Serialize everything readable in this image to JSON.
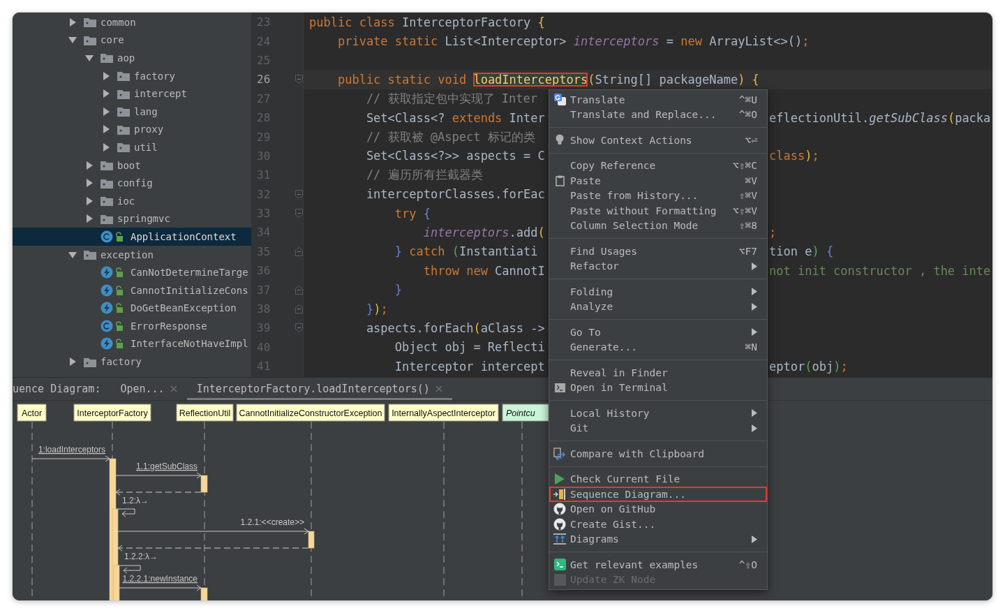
{
  "tree": [
    {
      "label": "common",
      "kind": "package",
      "expanded": false,
      "selected": false
    },
    {
      "label": "core",
      "kind": "package",
      "expanded": true,
      "selected": false,
      "children": [
        {
          "label": "aop",
          "kind": "package",
          "expanded": true,
          "selected": false,
          "children": [
            {
              "label": "factory",
              "kind": "package",
              "expanded": false,
              "selected": false
            },
            {
              "label": "intercept",
              "kind": "package",
              "expanded": false,
              "selected": false
            },
            {
              "label": "lang",
              "kind": "package",
              "expanded": false,
              "selected": false
            },
            {
              "label": "proxy",
              "kind": "package",
              "expanded": false,
              "selected": false
            },
            {
              "label": "util",
              "kind": "package",
              "expanded": false,
              "selected": false
            }
          ]
        },
        {
          "label": "boot",
          "kind": "package",
          "expanded": false,
          "selected": false
        },
        {
          "label": "config",
          "kind": "package",
          "expanded": false,
          "selected": false
        },
        {
          "label": "ioc",
          "kind": "package",
          "expanded": false,
          "selected": false
        },
        {
          "label": "springmvc",
          "kind": "package",
          "expanded": false,
          "selected": false
        },
        {
          "label": "ApplicationContext",
          "kind": "class",
          "selected": true
        }
      ]
    },
    {
      "label": "exception",
      "kind": "package",
      "expanded": true,
      "selected": false,
      "children": [
        {
          "label": "CanNotDetermineTarge",
          "kind": "exception",
          "selected": false
        },
        {
          "label": "CannotInitializeCons",
          "kind": "exception",
          "selected": false
        },
        {
          "label": "DoGetBeanException",
          "kind": "exception",
          "selected": false
        },
        {
          "label": "ErrorResponse",
          "kind": "class",
          "selected": false
        },
        {
          "label": "InterfaceNotHaveImpl",
          "kind": "exception",
          "selected": false
        }
      ]
    },
    {
      "label": "factory",
      "kind": "package",
      "expanded": false,
      "selected": false
    }
  ],
  "editor": {
    "lines": [
      {
        "number": "23",
        "current": false,
        "tokens": [
          {
            "text": "public class ",
            "kind": "keyword"
          },
          {
            "text": "InterceptorFactory ",
            "kind": "plain"
          },
          {
            "text": "{",
            "kind": "paren"
          }
        ]
      },
      {
        "number": "24",
        "current": false,
        "tokens": [
          {
            "text": "    private static ",
            "kind": "keyword"
          },
          {
            "text": "List<Interceptor> ",
            "kind": "plain"
          },
          {
            "text": "interceptors",
            "kind": "field"
          },
          {
            "text": " = ",
            "kind": "plain"
          },
          {
            "text": "new ",
            "kind": "keyword"
          },
          {
            "text": "ArrayList<>()",
            "kind": "plain"
          },
          {
            "text": ";",
            "kind": "keyword"
          }
        ]
      },
      {
        "number": "25",
        "current": false
      },
      {
        "number": "26",
        "current": true,
        "fold_start": true,
        "tokens": [
          {
            "text": "    public static void ",
            "kind": "keyword"
          },
          {
            "text": "loadInterceptors",
            "kind": "method",
            "boxed": true
          },
          {
            "text": "(",
            "kind": "paren"
          },
          {
            "text": "String[] packageName",
            "kind": "plain"
          },
          {
            "text": ")",
            "kind": "paren"
          },
          {
            "text": " {",
            "kind": "paren"
          }
        ]
      },
      {
        "number": "27",
        "current": false,
        "tokens": [
          {
            "text": "        // 获取指定包中实现了 Inter",
            "kind": "comment"
          }
        ]
      },
      {
        "number": "28",
        "current": false,
        "tokens": [
          {
            "text": "        Set<Class<? ",
            "kind": "plain"
          },
          {
            "text": "extends ",
            "kind": "keyword"
          },
          {
            "text": "Inter",
            "kind": "plain"
          }
        ],
        "tail": [
          {
            "text": "eflectionUtil.",
            "kind": "plain"
          },
          {
            "text": "getSubClass",
            "kind": "static"
          },
          {
            "text": "(",
            "kind": "paren"
          },
          {
            "text": "packa",
            "kind": "plain"
          }
        ]
      },
      {
        "number": "29",
        "current": false,
        "tokens": [
          {
            "text": "        // 获取被 @Aspect 标记的类",
            "kind": "comment"
          }
        ]
      },
      {
        "number": "30",
        "current": false,
        "tokens": [
          {
            "text": "        Set<Class<?>> aspects = C",
            "kind": "plain"
          }
        ],
        "tail": [
          {
            "text": "class",
            "kind": "keyword"
          },
          {
            "text": ")",
            "kind": "paren"
          },
          {
            "text": ";",
            "kind": "keyword"
          }
        ]
      },
      {
        "number": "31",
        "current": false,
        "tokens": [
          {
            "text": "        // 遍历所有拦截器类",
            "kind": "comment"
          }
        ]
      },
      {
        "number": "32",
        "current": false,
        "fold_start": true,
        "tokens": [
          {
            "text": "        interceptorClasses.forEac",
            "kind": "plain"
          }
        ]
      },
      {
        "number": "33",
        "current": false,
        "fold_start": true,
        "tokens": [
          {
            "text": "            try ",
            "kind": "keyword"
          },
          {
            "text": "{",
            "kind": "brace"
          }
        ]
      },
      {
        "number": "34",
        "current": false,
        "tokens": [
          {
            "text": "                interceptors",
            "kind": "field"
          },
          {
            "text": ".add",
            "kind": "plain"
          },
          {
            "text": "(",
            "kind": "paren"
          }
        ],
        "tail": [
          {
            "text": ";",
            "kind": "keyword"
          }
        ]
      },
      {
        "number": "35",
        "current": false,
        "fold_end": true,
        "tokens": [
          {
            "text": "            } ",
            "kind": "brace"
          },
          {
            "text": "catch ",
            "kind": "keyword"
          },
          {
            "text": "(",
            "kind": "paren2"
          },
          {
            "text": "Instantiati",
            "kind": "plain"
          }
        ],
        "tail": [
          {
            "text": "tion e",
            "kind": "plain"
          },
          {
            "text": ")",
            "kind": "paren2"
          },
          {
            "text": " {",
            "kind": "brace"
          }
        ]
      },
      {
        "number": "36",
        "current": false,
        "tokens": [
          {
            "text": "                throw new ",
            "kind": "keyword"
          },
          {
            "text": "CannotI",
            "kind": "plain"
          }
        ],
        "tail": [
          {
            "text": "not init constructor , the inte",
            "kind": "string"
          }
        ]
      },
      {
        "number": "37",
        "current": false,
        "fold_end": true,
        "tokens": [
          {
            "text": "            }",
            "kind": "brace"
          }
        ]
      },
      {
        "number": "38",
        "current": false,
        "fold_end": true,
        "tokens": [
          {
            "text": "        }",
            "kind": "brace"
          },
          {
            "text": ")",
            "kind": "paren"
          },
          {
            "text": ";",
            "kind": "keyword"
          }
        ]
      },
      {
        "number": "39",
        "current": false,
        "fold_start": true,
        "tokens": [
          {
            "text": "        aspects.forEach",
            "kind": "plain"
          },
          {
            "text": "(",
            "kind": "paren"
          },
          {
            "text": "aClass ->",
            "kind": "plain"
          }
        ]
      },
      {
        "number": "40",
        "current": false,
        "tokens": [
          {
            "text": "            Object obj = Reflecti",
            "kind": "plain"
          }
        ]
      },
      {
        "number": "41",
        "current": false,
        "tokens": [
          {
            "text": "            Interceptor intercept",
            "kind": "plain"
          }
        ],
        "tail": [
          {
            "text": "eptor",
            "kind": "plain"
          },
          {
            "text": "(",
            "kind": "paren2"
          },
          {
            "text": "obj",
            "kind": "plain"
          },
          {
            "text": ")",
            "kind": "paren2"
          },
          {
            "text": ";",
            "kind": "keyword"
          }
        ]
      }
    ]
  },
  "tool_window": {
    "title": "uence Diagram:",
    "tabs": [
      {
        "label": "Open...",
        "selected": false
      },
      {
        "label": "InterceptorFactory.loadInterceptors()",
        "selected": true
      }
    ]
  },
  "diagram": {
    "participants": [
      {
        "name": "Actor",
        "kind": "class"
      },
      {
        "name": "InterceptorFactory",
        "kind": "class"
      },
      {
        "name": "ReflectionUtil",
        "kind": "class"
      },
      {
        "name": "CannotInitializeConstructorException",
        "kind": "class"
      },
      {
        "name": "InternallyAspectInterceptor",
        "kind": "class"
      },
      {
        "name": "Pointcu",
        "kind": "interface"
      }
    ],
    "messages": [
      {
        "label": "1:loadInterceptors",
        "kind": "call",
        "underlined": true
      },
      {
        "label": "1.1:getSubClass",
        "kind": "call",
        "underlined": true
      },
      {
        "kind": "return"
      },
      {
        "label": "1.2:λ→",
        "kind": "self",
        "underlined": false
      },
      {
        "label": "1.2.1:<<create>>",
        "kind": "call",
        "underlined": false
      },
      {
        "kind": "return"
      },
      {
        "label": "1.2.2:λ→",
        "kind": "self",
        "underlined": false
      },
      {
        "label": "1.2.2.1:newInstance",
        "kind": "call",
        "underlined": true
      }
    ]
  },
  "context_menu": {
    "groups": [
      {
        "items": [
          {
            "label": "Translate",
            "shortcut": "^⌘U",
            "submenu": false,
            "disabled": false,
            "highlighted": false
          },
          {
            "label": "Translate and Replace...",
            "shortcut": "^⌘O",
            "submenu": false,
            "disabled": false,
            "highlighted": false
          }
        ]
      },
      {
        "items": [
          {
            "label": "Show Context Actions",
            "shortcut": "⌥⏎",
            "submenu": false,
            "disabled": false,
            "highlighted": false
          }
        ]
      },
      {
        "items": [
          {
            "label": "Copy Reference",
            "shortcut": "⌥⇧⌘C",
            "submenu": false,
            "disabled": false,
            "highlighted": false
          },
          {
            "label": "Paste",
            "shortcut": "⌘V",
            "submenu": false,
            "disabled": false,
            "highlighted": false
          },
          {
            "label": "Paste from History...",
            "shortcut": "⇧⌘V",
            "submenu": false,
            "disabled": false,
            "highlighted": false
          },
          {
            "label": "Paste without Formatting",
            "shortcut": "⌥⇧⌘V",
            "submenu": false,
            "disabled": false,
            "highlighted": false
          },
          {
            "label": "Column Selection Mode",
            "shortcut": "⇧⌘8",
            "submenu": false,
            "disabled": false,
            "highlighted": false
          }
        ]
      },
      {
        "items": [
          {
            "label": "Find Usages",
            "shortcut": "⌥F7",
            "submenu": false,
            "disabled": false,
            "highlighted": false
          },
          {
            "label": "Refactor",
            "submenu": true,
            "disabled": false,
            "highlighted": false
          }
        ]
      },
      {
        "items": [
          {
            "label": "Folding",
            "submenu": true,
            "disabled": false,
            "highlighted": false
          },
          {
            "label": "Analyze",
            "submenu": true,
            "disabled": false,
            "highlighted": false
          }
        ]
      },
      {
        "items": [
          {
            "label": "Go To",
            "submenu": true,
            "disabled": false,
            "highlighted": false
          },
          {
            "label": "Generate...",
            "shortcut": "⌘N",
            "submenu": false,
            "disabled": false,
            "highlighted": false
          }
        ]
      },
      {
        "items": [
          {
            "label": "Reveal in Finder",
            "submenu": false,
            "disabled": false,
            "highlighted": false
          },
          {
            "label": "Open in Terminal",
            "submenu": false,
            "disabled": false,
            "highlighted": false
          }
        ]
      },
      {
        "items": [
          {
            "label": "Local History",
            "submenu": true,
            "disabled": false,
            "highlighted": false
          },
          {
            "label": "Git",
            "submenu": true,
            "disabled": false,
            "highlighted": false
          }
        ]
      },
      {
        "items": [
          {
            "label": "Compare with Clipboard",
            "submenu": false,
            "disabled": false,
            "highlighted": false
          }
        ]
      },
      {
        "items": [
          {
            "label": "Check Current File",
            "submenu": false,
            "disabled": false,
            "highlighted": false
          },
          {
            "label": "Sequence Diagram...",
            "submenu": false,
            "disabled": false,
            "highlighted": true
          },
          {
            "label": "Open on GitHub",
            "submenu": false,
            "disabled": false,
            "highlighted": false
          },
          {
            "label": "Create Gist...",
            "submenu": false,
            "disabled": false,
            "highlighted": false
          },
          {
            "label": "Diagrams",
            "submenu": true,
            "disabled": false,
            "highlighted": false
          }
        ]
      },
      {
        "items": [
          {
            "label": "Get relevant examples",
            "shortcut": "^⇧O",
            "submenu": false,
            "disabled": false,
            "highlighted": false
          },
          {
            "label": "Update ZK Node",
            "submenu": false,
            "disabled": true,
            "highlighted": false
          }
        ]
      }
    ]
  }
}
